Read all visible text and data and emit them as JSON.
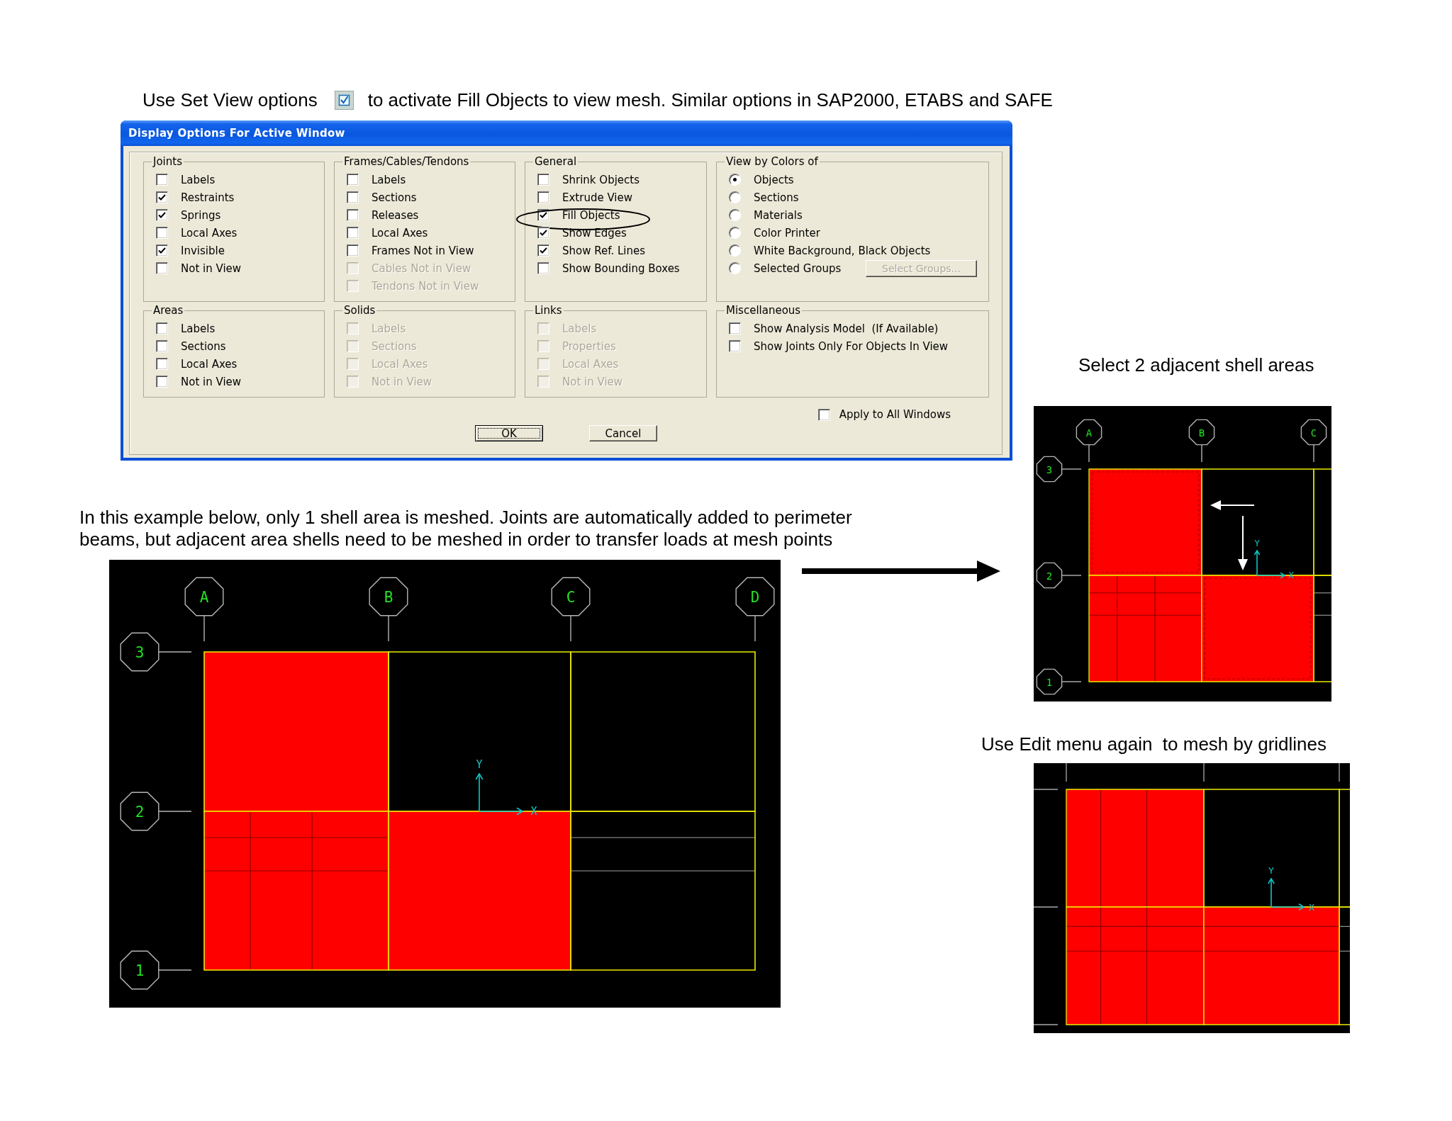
{
  "instruction": {
    "lead": "Use Set View options",
    "rest": "to activate Fill Objects to view mesh. Similar options in SAP2000, ETABS and SAFE"
  },
  "dialog": {
    "title": "Display Options For Active Window",
    "groups": [
      {
        "title": "Joints",
        "items": [
          {
            "kind": "checkbox",
            "label": "Labels",
            "checked": false,
            "disabled": false
          },
          {
            "kind": "checkbox",
            "label": "Restraints",
            "checked": true,
            "disabled": false
          },
          {
            "kind": "checkbox",
            "label": "Springs",
            "checked": true,
            "disabled": false
          },
          {
            "kind": "checkbox",
            "label": "Local Axes",
            "checked": false,
            "disabled": false
          },
          {
            "kind": "checkbox",
            "label": "Invisible",
            "checked": true,
            "disabled": false
          },
          {
            "kind": "checkbox",
            "label": "Not in View",
            "checked": false,
            "disabled": false
          }
        ]
      },
      {
        "title": "Frames/Cables/Tendons",
        "items": [
          {
            "kind": "checkbox",
            "label": "Labels",
            "checked": false,
            "disabled": false
          },
          {
            "kind": "checkbox",
            "label": "Sections",
            "checked": false,
            "disabled": false
          },
          {
            "kind": "checkbox",
            "label": "Releases",
            "checked": false,
            "disabled": false
          },
          {
            "kind": "checkbox",
            "label": "Local Axes",
            "checked": false,
            "disabled": false
          },
          {
            "kind": "checkbox",
            "label": "Frames Not in View",
            "checked": false,
            "disabled": false
          },
          {
            "kind": "checkbox",
            "label": "Cables Not in View",
            "checked": false,
            "disabled": true
          },
          {
            "kind": "checkbox",
            "label": "Tendons Not in View",
            "checked": false,
            "disabled": true
          }
        ]
      },
      {
        "title": "General",
        "items": [
          {
            "kind": "checkbox",
            "label": "Shrink Objects",
            "checked": false,
            "disabled": false,
            "circled": false
          },
          {
            "kind": "checkbox",
            "label": "Extrude View",
            "checked": false,
            "disabled": false,
            "circled": false
          },
          {
            "kind": "checkbox",
            "label": "Fill Objects",
            "checked": true,
            "disabled": false,
            "circled": true
          },
          {
            "kind": "checkbox",
            "label": "Show Edges",
            "checked": true,
            "disabled": false,
            "circled": false
          },
          {
            "kind": "checkbox",
            "label": "Show Ref. Lines",
            "checked": true,
            "disabled": false,
            "circled": false
          },
          {
            "kind": "checkbox",
            "label": "Show Bounding Boxes",
            "checked": false,
            "disabled": false,
            "circled": false
          }
        ]
      },
      {
        "title": "View by Colors of",
        "items": [
          {
            "kind": "radio",
            "label": "Objects",
            "selected": true
          },
          {
            "kind": "radio",
            "label": "Sections",
            "selected": false
          },
          {
            "kind": "radio",
            "label": "Materials",
            "selected": false
          },
          {
            "kind": "radio",
            "label": "Color Printer",
            "selected": false
          },
          {
            "kind": "radio",
            "label": "White Background, Black Objects",
            "selected": false
          },
          {
            "kind": "radio",
            "label": "Selected Groups",
            "selected": false,
            "button": {
              "label": "Select Groups...",
              "disabled": true
            }
          }
        ]
      },
      {
        "title": "Areas",
        "items": [
          {
            "kind": "checkbox",
            "label": "Labels",
            "checked": false,
            "disabled": false
          },
          {
            "kind": "checkbox",
            "label": "Sections",
            "checked": false,
            "disabled": false
          },
          {
            "kind": "checkbox",
            "label": "Local Axes",
            "checked": false,
            "disabled": false
          },
          {
            "kind": "checkbox",
            "label": "Not in View",
            "checked": false,
            "disabled": false
          }
        ]
      },
      {
        "title": "Solids",
        "items": [
          {
            "kind": "checkbox",
            "label": "Labels",
            "checked": false,
            "disabled": true
          },
          {
            "kind": "checkbox",
            "label": "Sections",
            "checked": false,
            "disabled": true
          },
          {
            "kind": "checkbox",
            "label": "Local Axes",
            "checked": false,
            "disabled": true
          },
          {
            "kind": "checkbox",
            "label": "Not in View",
            "checked": false,
            "disabled": true
          }
        ]
      },
      {
        "title": "Links",
        "items": [
          {
            "kind": "checkbox",
            "label": "Labels",
            "checked": false,
            "disabled": true
          },
          {
            "kind": "checkbox",
            "label": "Properties",
            "checked": false,
            "disabled": true
          },
          {
            "kind": "checkbox",
            "label": "Local Axes",
            "checked": false,
            "disabled": true
          },
          {
            "kind": "checkbox",
            "label": "Not in View",
            "checked": false,
            "disabled": true
          }
        ]
      },
      {
        "title": "Miscellaneous",
        "items": [
          {
            "kind": "checkbox",
            "label": "Show Analysis Model  (If Available)",
            "checked": false,
            "disabled": false
          },
          {
            "kind": "checkbox",
            "label": "Show Joints Only For Objects In View",
            "checked": false,
            "disabled": false
          }
        ]
      }
    ],
    "apply_all": {
      "label": "Apply to All Windows",
      "checked": false
    },
    "buttons": [
      {
        "label": "OK",
        "default": true
      },
      {
        "label": "Cancel",
        "default": false
      }
    ]
  },
  "selection": {
    "caption": "Select 2 adjacent shell areas",
    "plan": {
      "x_grids": [
        "A",
        "B",
        "C"
      ],
      "y_grids": [
        "3",
        "2",
        "1"
      ],
      "axis_labels": {
        "y": "Y",
        "x": "X"
      },
      "bays": [
        [
          {
            "filled": true,
            "selected": true,
            "mesh_columns": false,
            "mesh_rows": false
          },
          {
            "filled": false,
            "selected": false,
            "mesh_columns": false,
            "mesh_rows": false
          },
          {
            "filled": false,
            "selected": false,
            "mesh_columns": false,
            "mesh_rows": false
          }
        ],
        [
          {
            "filled": true,
            "selected": false,
            "mesh_columns": true,
            "mesh_rows": true
          },
          {
            "filled": true,
            "selected": true,
            "mesh_columns": false,
            "mesh_rows": false
          },
          {
            "filled": false,
            "selected": false,
            "mesh_columns": false,
            "mesh_rows": true
          }
        ]
      ]
    }
  },
  "example": {
    "text": "In this example below, only 1 shell area is meshed. Joints are automatically added to perimeter beams, but adjacent area shells need to be meshed in order to transfer loads at mesh points",
    "plan": {
      "x_grids": [
        "A",
        "B",
        "C",
        "D"
      ],
      "y_grids": [
        "3",
        "2",
        "1"
      ],
      "axis_labels": {
        "y": "Y",
        "x": "X"
      },
      "bays": [
        [
          {
            "filled": true,
            "selected": false,
            "mesh_columns": false,
            "mesh_rows": false
          },
          {
            "filled": false,
            "selected": false,
            "mesh_columns": false,
            "mesh_rows": false
          },
          {
            "filled": false,
            "selected": false,
            "mesh_columns": false,
            "mesh_rows": false
          }
        ],
        [
          {
            "filled": true,
            "selected": false,
            "mesh_columns": true,
            "mesh_rows": true
          },
          {
            "filled": true,
            "selected": false,
            "mesh_columns": false,
            "mesh_rows": false
          },
          {
            "filled": false,
            "selected": false,
            "mesh_columns": false,
            "mesh_rows": true
          }
        ]
      ]
    }
  },
  "gridline_mesh": {
    "caption": "Use Edit menu again  to mesh by gridlines",
    "plan": {
      "axis_labels": {
        "y": "Y",
        "x": "X"
      },
      "bays": [
        [
          {
            "filled": true,
            "selected": false,
            "mesh_columns": true,
            "mesh_rows": false
          },
          {
            "filled": false,
            "selected": false,
            "mesh_columns": false,
            "mesh_rows": false
          },
          {
            "filled": false,
            "selected": false,
            "mesh_columns": false,
            "mesh_rows": false
          }
        ],
        [
          {
            "filled": true,
            "selected": false,
            "mesh_columns": true,
            "mesh_rows": true
          },
          {
            "filled": true,
            "selected": false,
            "mesh_columns": false,
            "mesh_rows": true
          },
          {
            "filled": false,
            "selected": false,
            "mesh_columns": false,
            "mesh_rows": true
          }
        ]
      ]
    }
  }
}
